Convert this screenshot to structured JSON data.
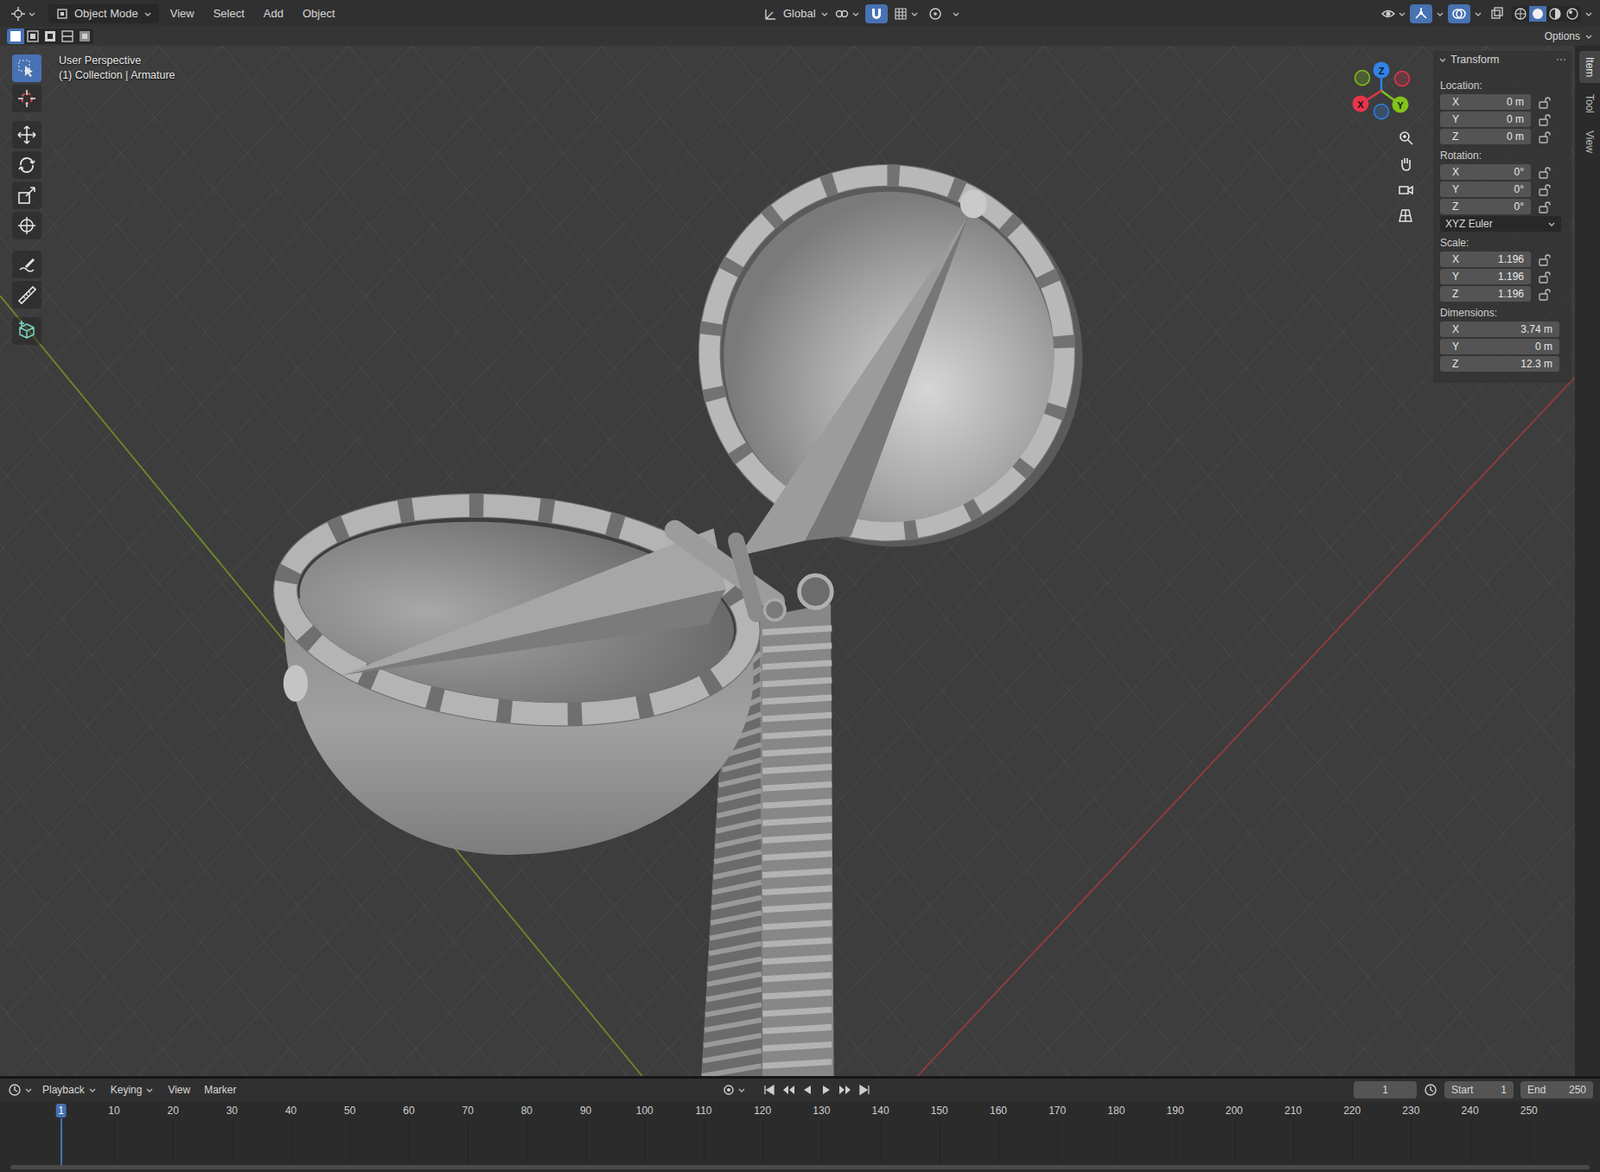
{
  "header": {
    "mode": "Object Mode",
    "menus": [
      "View",
      "Select",
      "Add",
      "Object"
    ],
    "orientation": "Global",
    "snap": true,
    "proportional_edit": false,
    "show_gizmos": true,
    "show_overlays": true,
    "xray": false,
    "shading": [
      {
        "kind": "wireframe",
        "selected": false
      },
      {
        "kind": "solid",
        "selected": true
      },
      {
        "kind": "material",
        "selected": false
      },
      {
        "kind": "rendered",
        "selected": false
      }
    ]
  },
  "tool_header": {
    "select_modes": [
      {
        "selected": true
      },
      {
        "selected": false
      },
      {
        "selected": false
      },
      {
        "selected": false
      },
      {
        "selected": false
      }
    ],
    "options": "Options"
  },
  "toolbar": [
    {
      "kind": "select",
      "selected": true
    },
    {
      "kind": "cursor",
      "selected": false
    },
    {
      "kind": "move",
      "selected": false
    },
    {
      "kind": "rotate",
      "selected": false
    },
    {
      "kind": "scale",
      "selected": false
    },
    {
      "kind": "transform",
      "selected": false
    },
    {
      "kind": "annotate",
      "selected": false
    },
    {
      "kind": "measure",
      "selected": false
    },
    {
      "kind": "add-cube",
      "selected": false
    }
  ],
  "viewport": {
    "view": "User Perspective",
    "context": "(1) Collection | Armature",
    "gizmo": [
      {
        "label": "Z",
        "color": "#2f83e6"
      },
      {
        "label": "Y",
        "color": "#82c21a"
      },
      {
        "label": "X",
        "color": "#e8344a"
      }
    ]
  },
  "sidebar": {
    "tabs": [
      {
        "label": "Item",
        "selected": true
      },
      {
        "label": "Tool",
        "selected": false
      },
      {
        "label": "View",
        "selected": false
      }
    ],
    "panel": {
      "title": "Transform",
      "expanded": true,
      "location": {
        "label": "Location:",
        "fields": [
          {
            "axis": "X",
            "value": "0 m",
            "locked": false
          },
          {
            "axis": "Y",
            "value": "0 m",
            "locked": false
          },
          {
            "axis": "Z",
            "value": "0 m",
            "locked": false
          }
        ]
      },
      "rotation": {
        "label": "Rotation:",
        "fields": [
          {
            "axis": "X",
            "value": "0°",
            "locked": false
          },
          {
            "axis": "Y",
            "value": "0°",
            "locked": false
          },
          {
            "axis": "Z",
            "value": "0°",
            "locked": false
          }
        ]
      },
      "rotation_mode": "XYZ Euler",
      "scale": {
        "label": "Scale:",
        "fields": [
          {
            "axis": "X",
            "value": "1.196",
            "locked": false
          },
          {
            "axis": "Y",
            "value": "1.196",
            "locked": false
          },
          {
            "axis": "Z",
            "value": "1.196",
            "locked": false
          }
        ]
      },
      "dimensions": {
        "label": "Dimensions:",
        "fields": [
          {
            "axis": "X",
            "value": "3.74 m"
          },
          {
            "axis": "Y",
            "value": "0 m"
          },
          {
            "axis": "Z",
            "value": "12.3 m"
          }
        ]
      }
    }
  },
  "timeline": {
    "menus": [
      "Playback",
      "Keying",
      "View",
      "Marker"
    ],
    "current_frame": "1",
    "start_label": "Start",
    "start": "1",
    "end_label": "End",
    "end": "250",
    "ticks": [
      "1",
      "10",
      "20",
      "30",
      "40",
      "50",
      "60",
      "70",
      "80",
      "90",
      "100",
      "110",
      "120",
      "130",
      "140",
      "150",
      "160",
      "170",
      "180",
      "190",
      "200",
      "210",
      "220",
      "230",
      "240",
      "250"
    ]
  }
}
